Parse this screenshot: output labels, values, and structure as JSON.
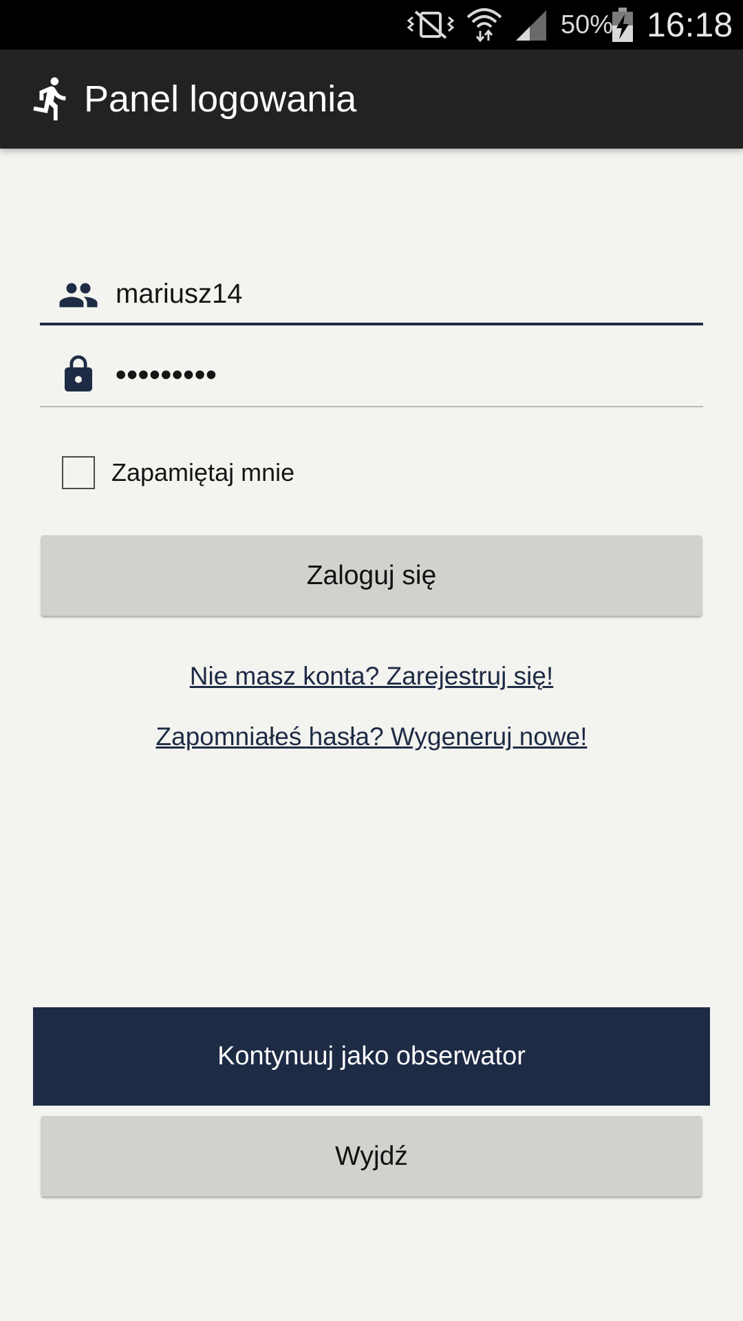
{
  "status_bar": {
    "battery_percent": "50%",
    "time": "16:18",
    "icons": [
      "vibrate-mute-icon",
      "wifi-icon",
      "signal-icon",
      "battery-charging-icon"
    ]
  },
  "app_bar": {
    "title": "Panel logowania",
    "icon": "running-person-icon"
  },
  "login_form": {
    "username": {
      "value": "mariusz14",
      "icon": "people-icon"
    },
    "password": {
      "value": "•••••••••",
      "icon": "lock-icon"
    },
    "remember_me": {
      "label": "Zapamiętaj mnie",
      "checked": false
    },
    "login_button": "Zaloguj się",
    "register_link": "Nie masz konta? Zarejestruj się!",
    "forgot_link": "Zapomniałeś hasła? Wygeneruj nowe!"
  },
  "bottom_actions": {
    "observer_button": "Kontynuuj jako obserwator",
    "exit_button": "Wyjdź"
  },
  "colors": {
    "accent": "#1e2b45",
    "background": "#f3f3ef",
    "button_grey": "#d1d1cd",
    "app_bar": "#222222"
  }
}
